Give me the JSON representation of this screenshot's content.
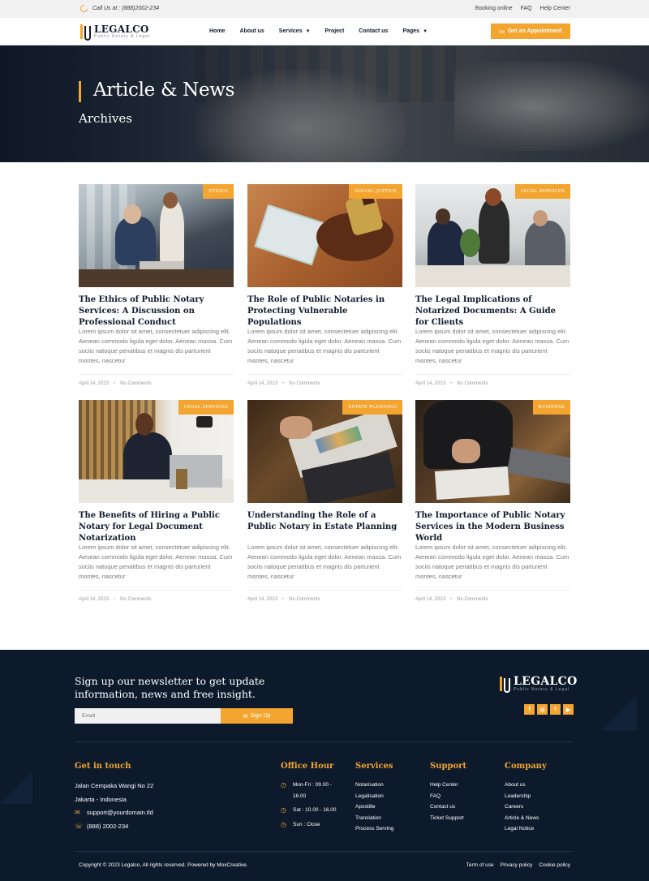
{
  "topbar": {
    "call_text": "Call Us at : (888)2002-234",
    "links": [
      "Booking online",
      "FAQ",
      "Help Center"
    ]
  },
  "brand": {
    "name": "LEGALCO",
    "tagline": "Public Notary & Legal"
  },
  "nav": {
    "items": [
      {
        "label": "Home",
        "dropdown": false
      },
      {
        "label": "About us",
        "dropdown": false
      },
      {
        "label": "Services",
        "dropdown": true
      },
      {
        "label": "Project",
        "dropdown": false
      },
      {
        "label": "Contact us",
        "dropdown": false
      },
      {
        "label": "Pages",
        "dropdown": true
      }
    ],
    "cta_label": "Get an Appointment"
  },
  "hero": {
    "title": "Article & News",
    "subtitle": "Archives"
  },
  "posts": [
    {
      "category": "ETHICS",
      "title": "The Ethics of Public Notary Services: A Discussion on Professional Conduct",
      "excerpt": "Lorem ipsum dolor sit amet, consectetuer adipiscing elit. Aenean commodo ligula eget dolor. Aenean massa. Cum sociis natoque penatibus et magnis dis parturient montes, nascetur",
      "date": "April 14, 2023",
      "comments": "No Comments"
    },
    {
      "category": "SOCIAL JUSTICE",
      "title": "The Role of Public Notaries in Protecting Vulnerable Populations",
      "excerpt": "Lorem ipsum dolor sit amet, consectetuer adipiscing elit. Aenean commodo ligula eget dolor. Aenean massa. Cum sociis natoque penatibus et magnis dis parturient montes, nascetur",
      "date": "April 14, 2023",
      "comments": "No Comments"
    },
    {
      "category": "LEGAL SERVICES",
      "title": "The Legal Implications of Notarized Documents: A Guide for Clients",
      "excerpt": "Lorem ipsum dolor sit amet, consectetuer adipiscing elit. Aenean commodo ligula eget dolor. Aenean massa. Cum sociis natoque penatibus et magnis dis parturient montes, nascetur",
      "date": "April 14, 2023",
      "comments": "No Comments"
    },
    {
      "category": "LEGAL SERVICES",
      "title": "The Benefits of Hiring a Public Notary for Legal Document Notarization",
      "excerpt": "Lorem ipsum dolor sit amet, consectetuer adipiscing elit. Aenean commodo ligula eget dolor. Aenean massa. Cum sociis natoque penatibus et magnis dis parturient montes, nascetur",
      "date": "April 14, 2023",
      "comments": "No Comments"
    },
    {
      "category": "ESTATE PLANNING",
      "title": "Understanding the Role of a Public Notary in Estate Planning",
      "excerpt": "Lorem ipsum dolor sit amet, consectetuer adipiscing elit. Aenean commodo ligula eget dolor. Aenean massa. Cum sociis natoque penatibus et magnis dis parturient montes, nascetur",
      "date": "April 14, 2023",
      "comments": "No Comments"
    },
    {
      "category": "BUSINESS",
      "title": "The Importance of Public Notary Services in the Modern Business World",
      "excerpt": "Lorem ipsum dolor sit amet, consectetuer adipiscing elit. Aenean commodo ligula eget dolor. Aenean massa. Cum sociis natoque penatibus et magnis dis parturient montes, nascetur",
      "date": "April 14, 2023",
      "comments": "No Comments"
    }
  ],
  "newsletter": {
    "text": "Sign up our newsletter to get update information, news and free insight.",
    "placeholder": "Email",
    "button": "Sign Up"
  },
  "footer": {
    "get_in_touch": {
      "title": "Get in touch",
      "address_line1": "Jalan Cempaka Wangi No 22",
      "address_line2": "Jakarta - Indonesia",
      "email": "support@yourdomain.tld",
      "phone": "(888) 2002-234"
    },
    "office_hour": {
      "title": "Office Hour",
      "hours": [
        "Mon-Fri : 09.00 - 16.00",
        "Sat : 10.00 - 16.00",
        "Sun : Close"
      ]
    },
    "services": {
      "title": "Services",
      "items": [
        "Notarisation",
        "Legalisation",
        "Apostille",
        "Translation",
        "Process Serving"
      ]
    },
    "support": {
      "title": "Support",
      "items": [
        "Help Center",
        "FAQ",
        "Contact us",
        "Ticket Support"
      ]
    },
    "company": {
      "title": "Company",
      "items": [
        "About us",
        "Leadership",
        "Careers",
        "Article & News",
        "Legal Notice"
      ]
    },
    "copyright": "Copyright © 2023 Legalco, All rights reserved. Powered by MoxCreative.",
    "legal_links": [
      "Term of use",
      "Privacy policy",
      "Cookie policy"
    ]
  },
  "colors": {
    "accent": "#f3a530",
    "navy": "#0d1a2c",
    "text": "#0f1b2d"
  }
}
